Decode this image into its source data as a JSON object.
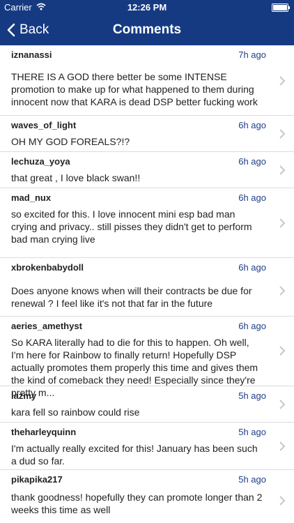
{
  "status": {
    "carrier": "Carrier",
    "time": "12:26 PM"
  },
  "nav": {
    "back_label": "Back",
    "title": "Comments"
  },
  "comments": [
    {
      "user": "iznanassi",
      "time": "7h ago",
      "text": "THERE IS A GOD there better be some INTENSE promotion to make up for what happened to them during innocent now that KARA is dead DSP better fucking work"
    },
    {
      "user": "waves_of_light",
      "time": "6h ago",
      "text": "OH MY GOD FOREALS?!?"
    },
    {
      "user": "lechuza_yoya",
      "time": "6h ago",
      "text": "that great , I love black swan!!"
    },
    {
      "user": "mad_nux",
      "time": "6h ago",
      "text": "so excited for this. I love innocent mini esp bad man crying and privacy.. still pisses they didn't get to perform bad man crying live"
    },
    {
      "user": "xbrokenbabydoll",
      "time": "6h ago",
      "text": "Does anyone knows when will their contracts be due for renewal ? I feel like it's not that far in the future"
    },
    {
      "user": "aeries_amethyst",
      "time": "6h ago",
      "text": "So KARA literally had to die for this to happen. Oh well, I'm here for Rainbow to finally return! Hopefully DSP actually promotes them properly this time and gives them the kind of comeback they need! Especially since they're pretty m..."
    },
    {
      "user": "lazmy",
      "time": "5h ago",
      "text": "kara fell so rainbow could rise"
    },
    {
      "user": "theharleyquinn",
      "time": "5h ago",
      "text": "I'm actually really excited for this! January has been such a dud so far."
    },
    {
      "user": "pikapika217",
      "time": "5h ago",
      "text": "thank goodness! hopefully they can promote longer than 2 weeks this time as well"
    }
  ]
}
